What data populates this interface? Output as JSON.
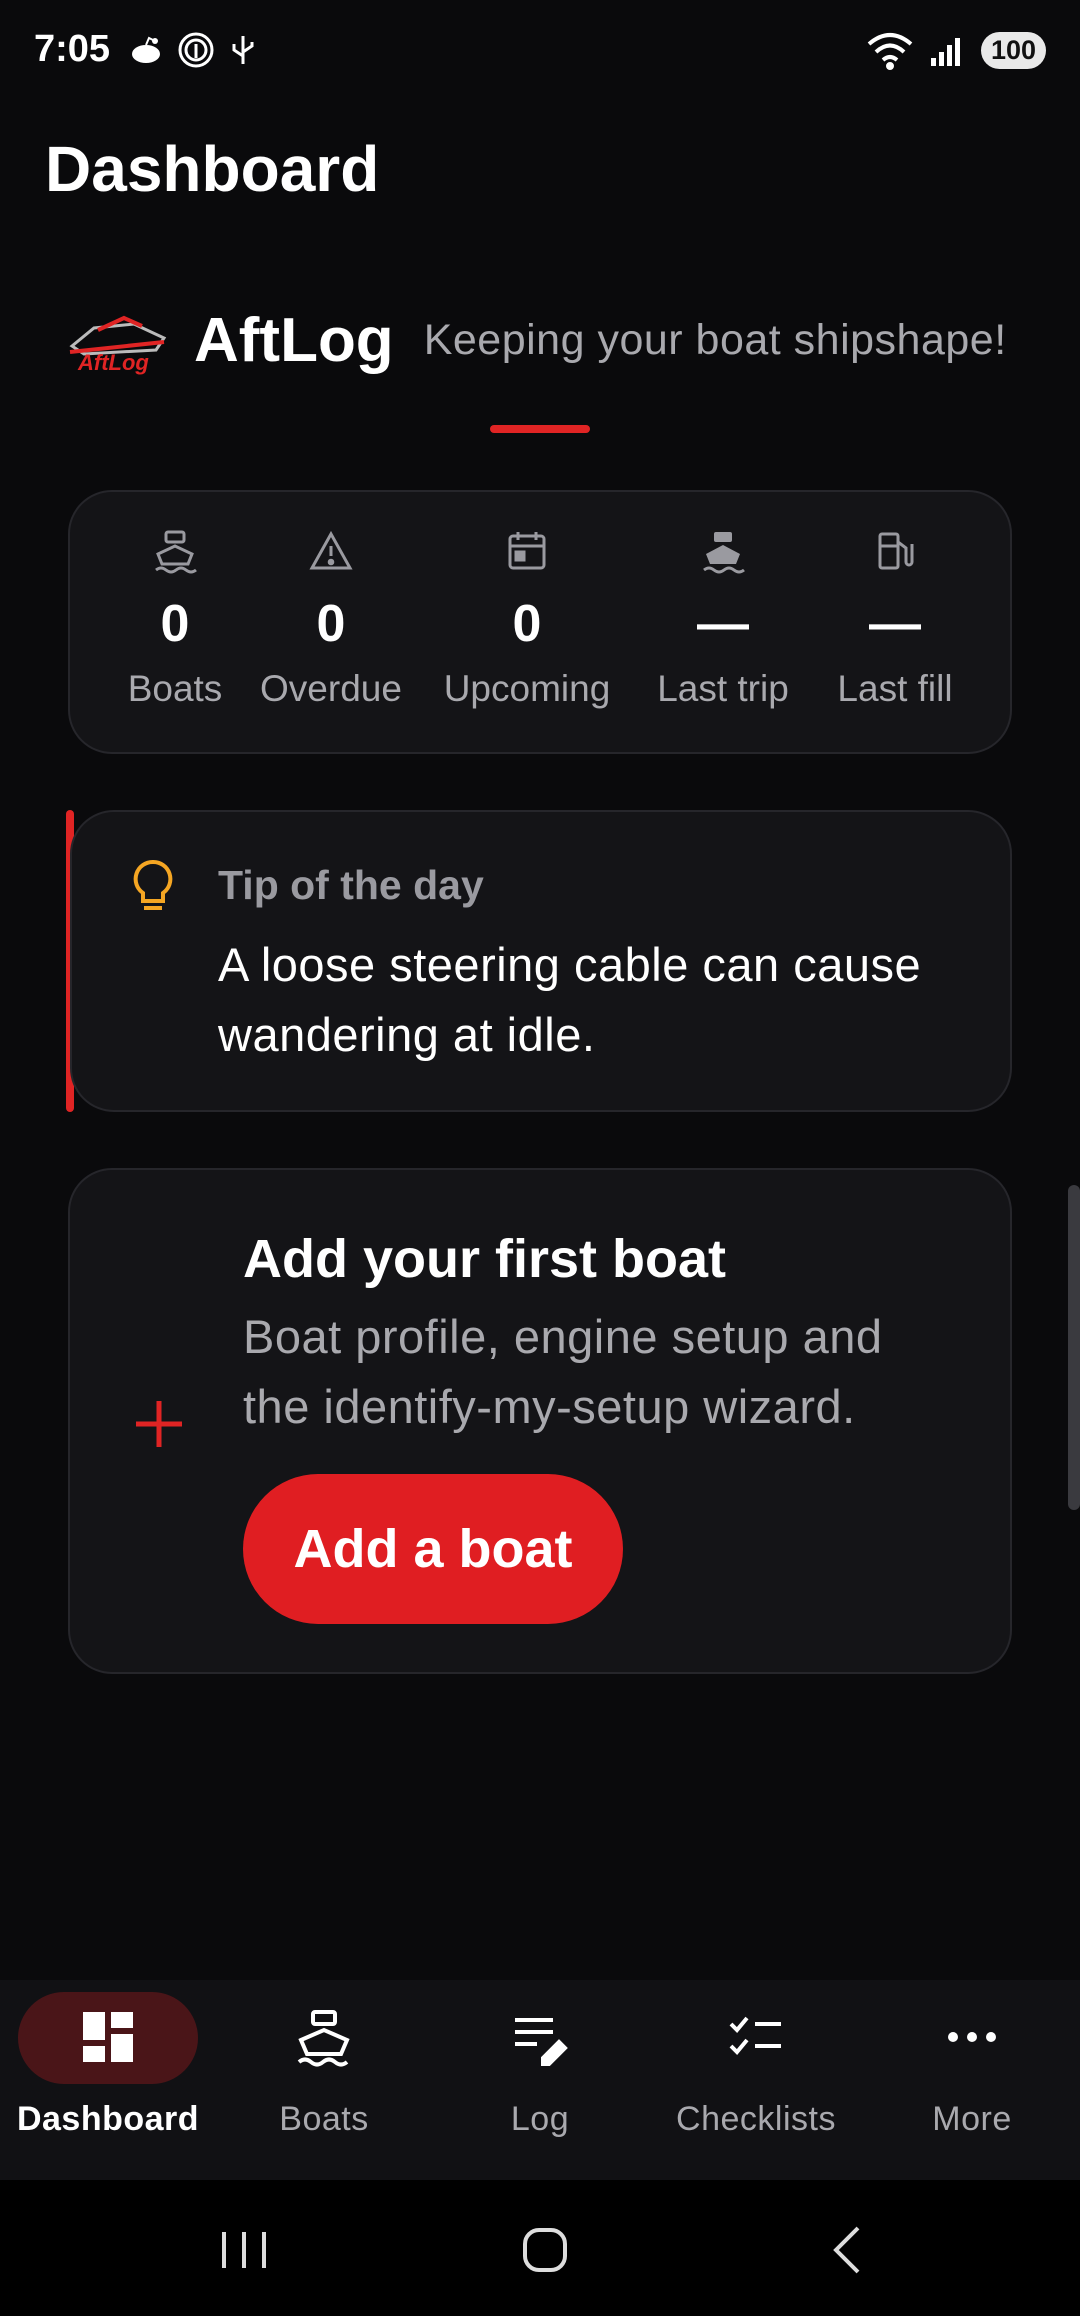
{
  "status_bar": {
    "time": "7:05",
    "battery": "100"
  },
  "header": {
    "title": "Dashboard"
  },
  "brand": {
    "name": "AftLog",
    "tagline": "Keeping your boat shipshape!",
    "logo_text": "AftLog"
  },
  "stats": [
    {
      "icon": "boat-icon",
      "value": "0",
      "label": "Boats"
    },
    {
      "icon": "warning-icon",
      "value": "0",
      "label": "Overdue"
    },
    {
      "icon": "calendar-icon",
      "value": "0",
      "label": "Upcoming"
    },
    {
      "icon": "ship-icon",
      "value": "—",
      "label": "Last trip"
    },
    {
      "icon": "fuel-icon",
      "value": "—",
      "label": "Last fill"
    }
  ],
  "tip": {
    "icon": "lightbulb-icon",
    "title": "Tip of the day",
    "text": "A loose steering cable can cause wandering at idle."
  },
  "add_boat": {
    "icon": "plus-icon",
    "title": "Add your first boat",
    "description": "Boat profile, engine setup and the identify-my-setup wizard.",
    "button_label": "Add a boat"
  },
  "bottom_nav": [
    {
      "icon": "dashboard-icon",
      "label": "Dashboard",
      "active": true
    },
    {
      "icon": "boat-icon",
      "label": "Boats",
      "active": false
    },
    {
      "icon": "log-icon",
      "label": "Log",
      "active": false
    },
    {
      "icon": "checklist-icon",
      "label": "Checklists",
      "active": false
    },
    {
      "icon": "more-icon",
      "label": "More",
      "active": false
    }
  ],
  "colors": {
    "accent": "#e01e22",
    "background": "#0a0a0c",
    "card": "#141417",
    "tip_icon": "#f5a623"
  }
}
